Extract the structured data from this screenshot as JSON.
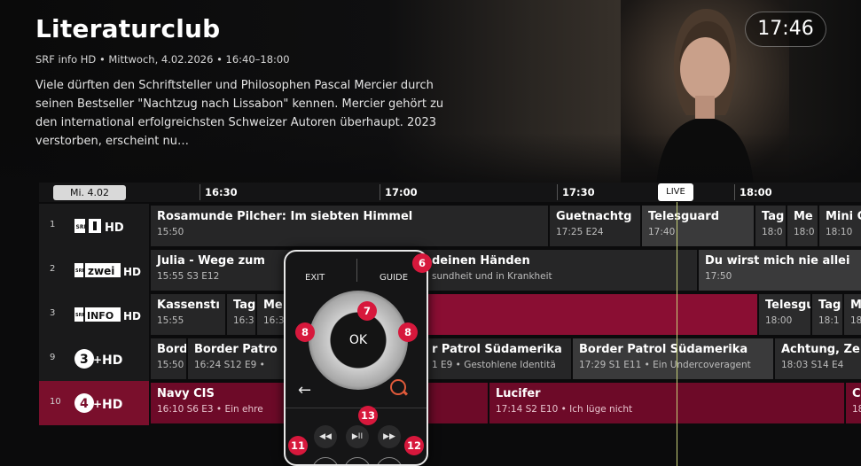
{
  "hero": {
    "title": "Literaturclub",
    "meta": "SRF info HD • Mittwoch, 4.02.2026 • 16:40–18:00",
    "description": "Viele dürften den Schriftsteller und Philosophen Pascal Mercier durch seinen Bestseller \"Nachtzug nach Lissabon\" kennen. Mercier gehört zu den international erfolgreichsten Schweizer Autoren überhaupt. 2023 verstorben, erscheint nu…",
    "clock": "17:46"
  },
  "timeline": {
    "date": "Mi. 4.02",
    "ticks": [
      "16:30",
      "17:00",
      "17:30",
      "18:00"
    ],
    "live": "LIVE"
  },
  "channels": [
    {
      "num": "1",
      "logo": "SRF 1 HD",
      "programs": [
        {
          "title": "Rosamunde Pilcher: Im siebten Himmel",
          "sub": "15:50"
        },
        {
          "title": "Guetnachtg",
          "sub": "17:25  E24"
        },
        {
          "title": "Telesguard",
          "sub": "17:40"
        },
        {
          "title": "Tag",
          "sub": "18:0"
        },
        {
          "title": "Me",
          "sub": "18:0"
        },
        {
          "title": "Mini C",
          "sub": "18:10"
        }
      ]
    },
    {
      "num": "2",
      "logo": "SRF zwei HD",
      "programs": [
        {
          "title": "Julia - Wege zum",
          "sub": "15:55  S3 E12"
        },
        {
          "title": "deinen Händen",
          "sub": "sundheit und in Krankheit"
        },
        {
          "title": "Du wirst mich nie allei",
          "sub": "17:50"
        }
      ]
    },
    {
      "num": "3",
      "logo": "SRF INFO HD",
      "programs": [
        {
          "title": "Kassenstı",
          "sub": "15:55"
        },
        {
          "title": "Tag",
          "sub": "16:3"
        },
        {
          "title": "Me",
          "sub": "16:3"
        },
        {
          "title": "Telesgu",
          "sub": "18:00"
        },
        {
          "title": "Tag",
          "sub": "18:1"
        },
        {
          "title": "M",
          "sub": "18"
        }
      ]
    },
    {
      "num": "9",
      "logo": "3+HD",
      "programs": [
        {
          "title": "Bord",
          "sub": "15:50"
        },
        {
          "title": "Border Patro",
          "sub": "16:24  S12 E9 •"
        },
        {
          "title": "r Patrol Südamerika",
          "sub": "1 E9 • Gestohlene Identitä"
        },
        {
          "title": "Border Patrol Südamerika",
          "sub": "17:29  S1 E11 • Ein Undercoveragent"
        },
        {
          "title": "Achtung, Ze",
          "sub": "18:03  S14 E4"
        }
      ]
    },
    {
      "num": "10",
      "logo": "4+HD",
      "programs": [
        {
          "title": "Navy CIS",
          "sub": "16:10  S6 E3 • Ein ehre"
        },
        {
          "title": "Lucifer",
          "sub": "17:14  S2 E10 • Ich lüge nicht"
        },
        {
          "title": "C",
          "sub": "18"
        }
      ]
    }
  ],
  "remote": {
    "exit": "EXIT",
    "guide": "GUIDE",
    "ok": "OK",
    "back_icon": "arrow-left-icon",
    "search_icon": "search-icon",
    "rewind": "◀◀",
    "playpause": "▶II",
    "forward": "▶▶"
  },
  "badges": [
    "6",
    "7",
    "8",
    "8",
    "11",
    "12",
    "13"
  ],
  "colors": {
    "accent_red": "#d7183c",
    "selected_row": "#7a0f2c",
    "live_line": "#c8d27a"
  }
}
